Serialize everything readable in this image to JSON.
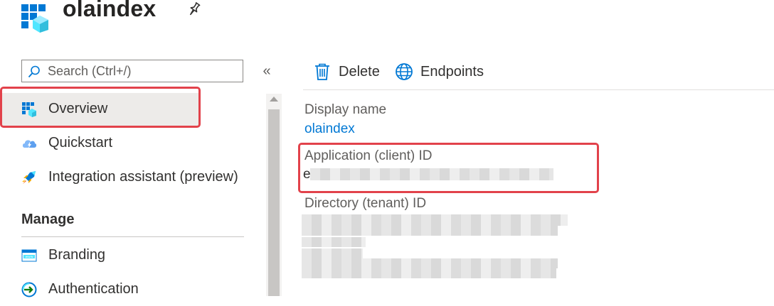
{
  "header": {
    "title": "olaindex"
  },
  "search": {
    "placeholder": "Search (Ctrl+/)"
  },
  "nav": {
    "collapse_label": "«",
    "items": [
      {
        "label": "Overview",
        "icon": "app-grid-icon",
        "selected": true
      },
      {
        "label": "Quickstart",
        "icon": "cloud-bolt-icon"
      },
      {
        "label": "Integration assistant (preview)",
        "icon": "rocket-icon"
      }
    ],
    "manage_section": "Manage",
    "manage_items": [
      {
        "label": "Branding",
        "icon": "branding-icon"
      },
      {
        "label": "Authentication",
        "icon": "authentication-icon"
      }
    ]
  },
  "toolbar": {
    "delete_label": "Delete",
    "endpoints_label": "Endpoints"
  },
  "essentials": {
    "display_name_label": "Display name",
    "display_name_value": "olaindex",
    "app_id_label": "Application (client) ID",
    "app_id_visible_char": "e",
    "tenant_id_label": "Directory (tenant) ID"
  },
  "colors": {
    "accent": "#0078d4",
    "highlight": "#e2424b",
    "selected_bg": "#edebe9"
  }
}
